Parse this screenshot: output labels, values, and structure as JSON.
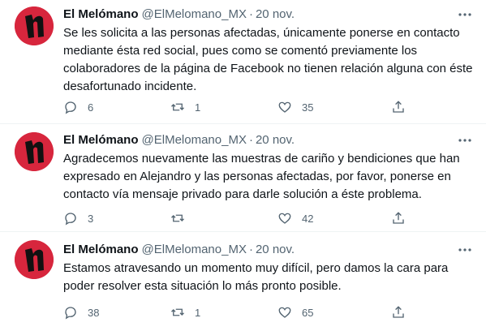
{
  "tweets": [
    {
      "name": "El Melómano",
      "handle": "@ElMelomano_MX",
      "date": "20 nov.",
      "text": "Se les solicita a las personas afectadas, únicamente ponerse en contacto mediante ésta red social, pues como se comentó previamente los colaboradores de la página de Facebook no tienen relación alguna con éste desafortunado incidente.",
      "replies": "6",
      "retweets": "1",
      "likes": "35"
    },
    {
      "name": "El Melómano",
      "handle": "@ElMelomano_MX",
      "date": "20 nov.",
      "text": "Agradecemos nuevamente las muestras de cariño y bendiciones que han expresado en Alejandro y las personas afectadas, por favor, ponerse en contacto vía mensaje privado para darle solución a éste problema.",
      "replies": "3",
      "retweets": "",
      "likes": "42"
    },
    {
      "name": "El Melómano",
      "handle": "@ElMelomano_MX",
      "date": "20 nov.",
      "text": "Estamos atravesando un momento muy difícil, pero damos la cara para poder resolver esta situación lo más pronto posible.",
      "replies": "38",
      "retweets": "1",
      "likes": "65"
    }
  ],
  "icons": {
    "avatar": "el-melomano-logo",
    "more": "more-dots-icon",
    "reply": "reply-icon",
    "retweet": "retweet-icon",
    "like": "heart-icon",
    "share": "share-icon"
  },
  "colors": {
    "text": "#0f1419",
    "muted": "#536471",
    "avatar_bg": "#d7263d"
  }
}
